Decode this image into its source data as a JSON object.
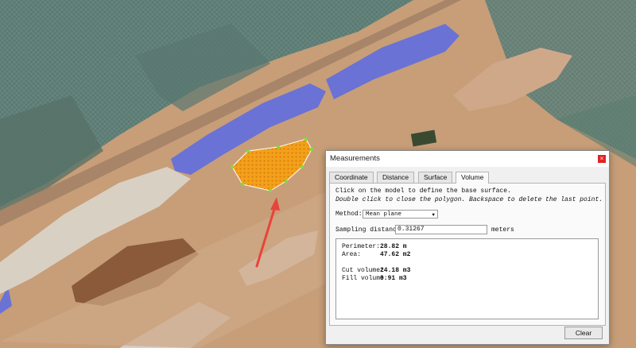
{
  "window": {
    "title": "Measurements",
    "close_symbol": "×"
  },
  "tabs": [
    {
      "label": "Coordinate",
      "active": false
    },
    {
      "label": "Distance",
      "active": false
    },
    {
      "label": "Surface",
      "active": false
    },
    {
      "label": "Volume",
      "active": true
    }
  ],
  "instructions": {
    "line1": "Click on the model to define the base surface.",
    "line2": "Double click to close the polygon. Backspace to delete the last point."
  },
  "method": {
    "label": "Method:",
    "value": "Mean plane"
  },
  "sampling": {
    "label": "Sampling distance:",
    "value": "0.31267",
    "unit": "meters"
  },
  "results": {
    "perimeter_label": "Perimeter:",
    "perimeter_value": "28.82 m",
    "area_label": "Area:",
    "area_value": "47.62 m2",
    "cut_label": "Cut volume:",
    "cut_value": "24.18 m3",
    "fill_label": "Fill volume:",
    "fill_value": "0.91 m3"
  },
  "buttons": {
    "clear": "Clear"
  },
  "colors": {
    "tarp_blue": "#6a72d6",
    "dirt": "#c9a07a",
    "netting": "#5f7f78",
    "measure_fill": "#f0a020",
    "annotation_arrow": "#e8443a"
  }
}
